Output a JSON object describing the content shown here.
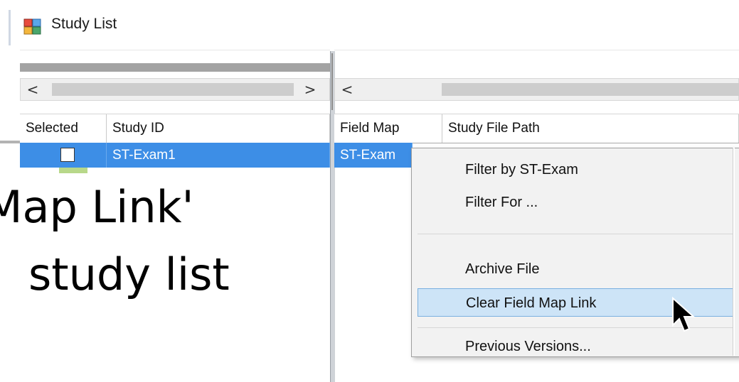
{
  "window": {
    "title": "Study List",
    "icon": "app-window-icon"
  },
  "scroll": {
    "left_arrow": "<",
    "right_arrow": ">"
  },
  "grid": {
    "left_columns": [
      "Selected",
      "Study ID"
    ],
    "right_columns": [
      "Field Map",
      "Study File Path"
    ],
    "selected_row": {
      "study_id": "ST-Exam1",
      "field_map": "ST-Exam"
    },
    "accent": "#3d8ee6"
  },
  "overlay": {
    "line1": "Map Link'",
    "line2": "study list"
  },
  "context_menu": {
    "items": [
      {
        "label": "Filter by ST-Exam"
      },
      {
        "label": "Filter For ..."
      },
      {
        "label": "Archive File"
      },
      {
        "label": "Clear Field Map Link"
      },
      {
        "label": "Previous Versions..."
      }
    ],
    "highlight_color": "#cde4f7"
  }
}
